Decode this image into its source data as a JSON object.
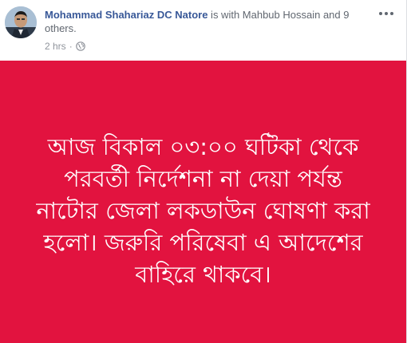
{
  "post": {
    "author": "Mohammad Shahariaz DC Natore",
    "with_prefix": " is with ",
    "tagged_person": "Mahbub Hossain",
    "and_text": " and ",
    "others_link": "9 others",
    "end_punct": ".",
    "timestamp": "2 hrs",
    "separator": "·",
    "privacy_icon": "globe-icon",
    "menu_icon": "more-options-icon"
  },
  "card": {
    "background_color": "#e2133f",
    "text_color": "#ffffff",
    "lines": [
      "আজ বিকাল ০৩:০০ ঘটিকা থেকে",
      "পরবর্তী নির্দেশনা না দেয়া পর্যন্ত",
      "নাটোর জেলা লকডাউন ঘোষণা করা",
      "হলো। জরুরি পরিষেবা এ আদেশের",
      "বাহিরে থাকবে।"
    ]
  }
}
